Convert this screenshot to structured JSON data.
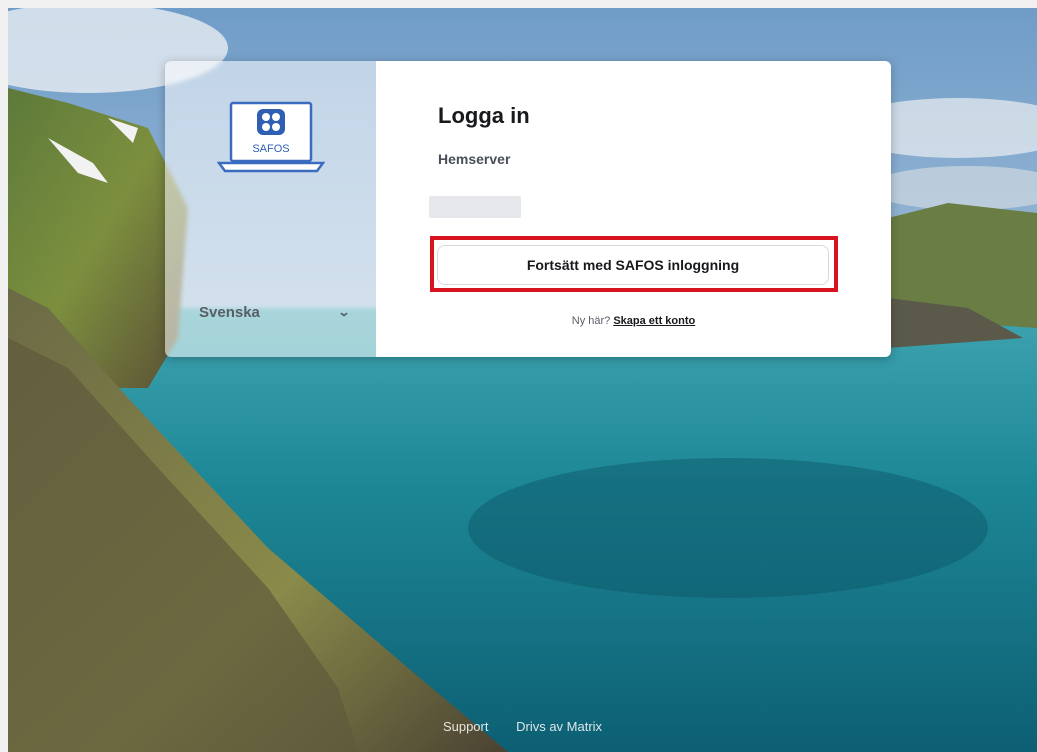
{
  "login": {
    "title": "Logga in",
    "server_label": "Hemserver",
    "server_value": "",
    "sso_button": "Fortsätt med SAFOS inloggning",
    "signup_prompt": "Ny här?",
    "signup_link": "Skapa ett konto"
  },
  "sidebar": {
    "logo_text": "SAFOS",
    "language": "Svenska"
  },
  "footer": {
    "support": "Support",
    "powered_by": "Drivs av Matrix"
  },
  "icons": {
    "language_dropdown": "chevron-down-icon",
    "logo": "laptop-logo-icon"
  },
  "colors": {
    "highlight": "#d7131f",
    "logo_blue": "#3b6bbf"
  }
}
